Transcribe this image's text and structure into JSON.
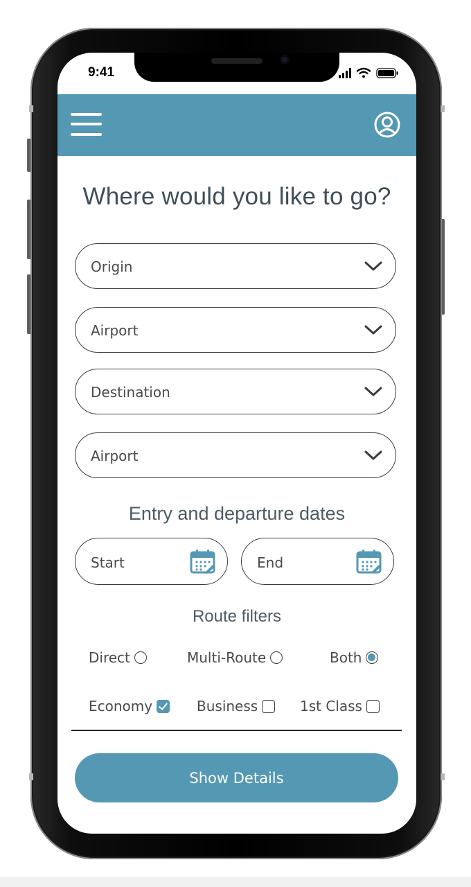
{
  "status_bar": {
    "time": "9:41"
  },
  "header": {
    "menu_icon": "hamburger-menu-icon",
    "profile_icon": "user-profile-icon",
    "color": "#5598b3"
  },
  "page": {
    "title": "Where would you like to go?"
  },
  "form": {
    "origin": {
      "label": "Origin"
    },
    "origin_airport": {
      "label": "Airport"
    },
    "destination": {
      "label": "Destination"
    },
    "destination_airport": {
      "label": "Airport"
    }
  },
  "dates": {
    "title": "Entry and departure dates",
    "start": {
      "label": "Start"
    },
    "end": {
      "label": "End"
    }
  },
  "filters": {
    "title": "Route filters",
    "route_options": [
      {
        "label": "Direct",
        "selected": false
      },
      {
        "label": "Multi-Route",
        "selected": false
      },
      {
        "label": "Both",
        "selected": true
      }
    ],
    "class_options": [
      {
        "label": "Economy",
        "checked": true
      },
      {
        "label": "Business",
        "checked": false
      },
      {
        "label": "1st Class",
        "checked": false
      }
    ]
  },
  "actions": {
    "show_details": "Show Details"
  }
}
